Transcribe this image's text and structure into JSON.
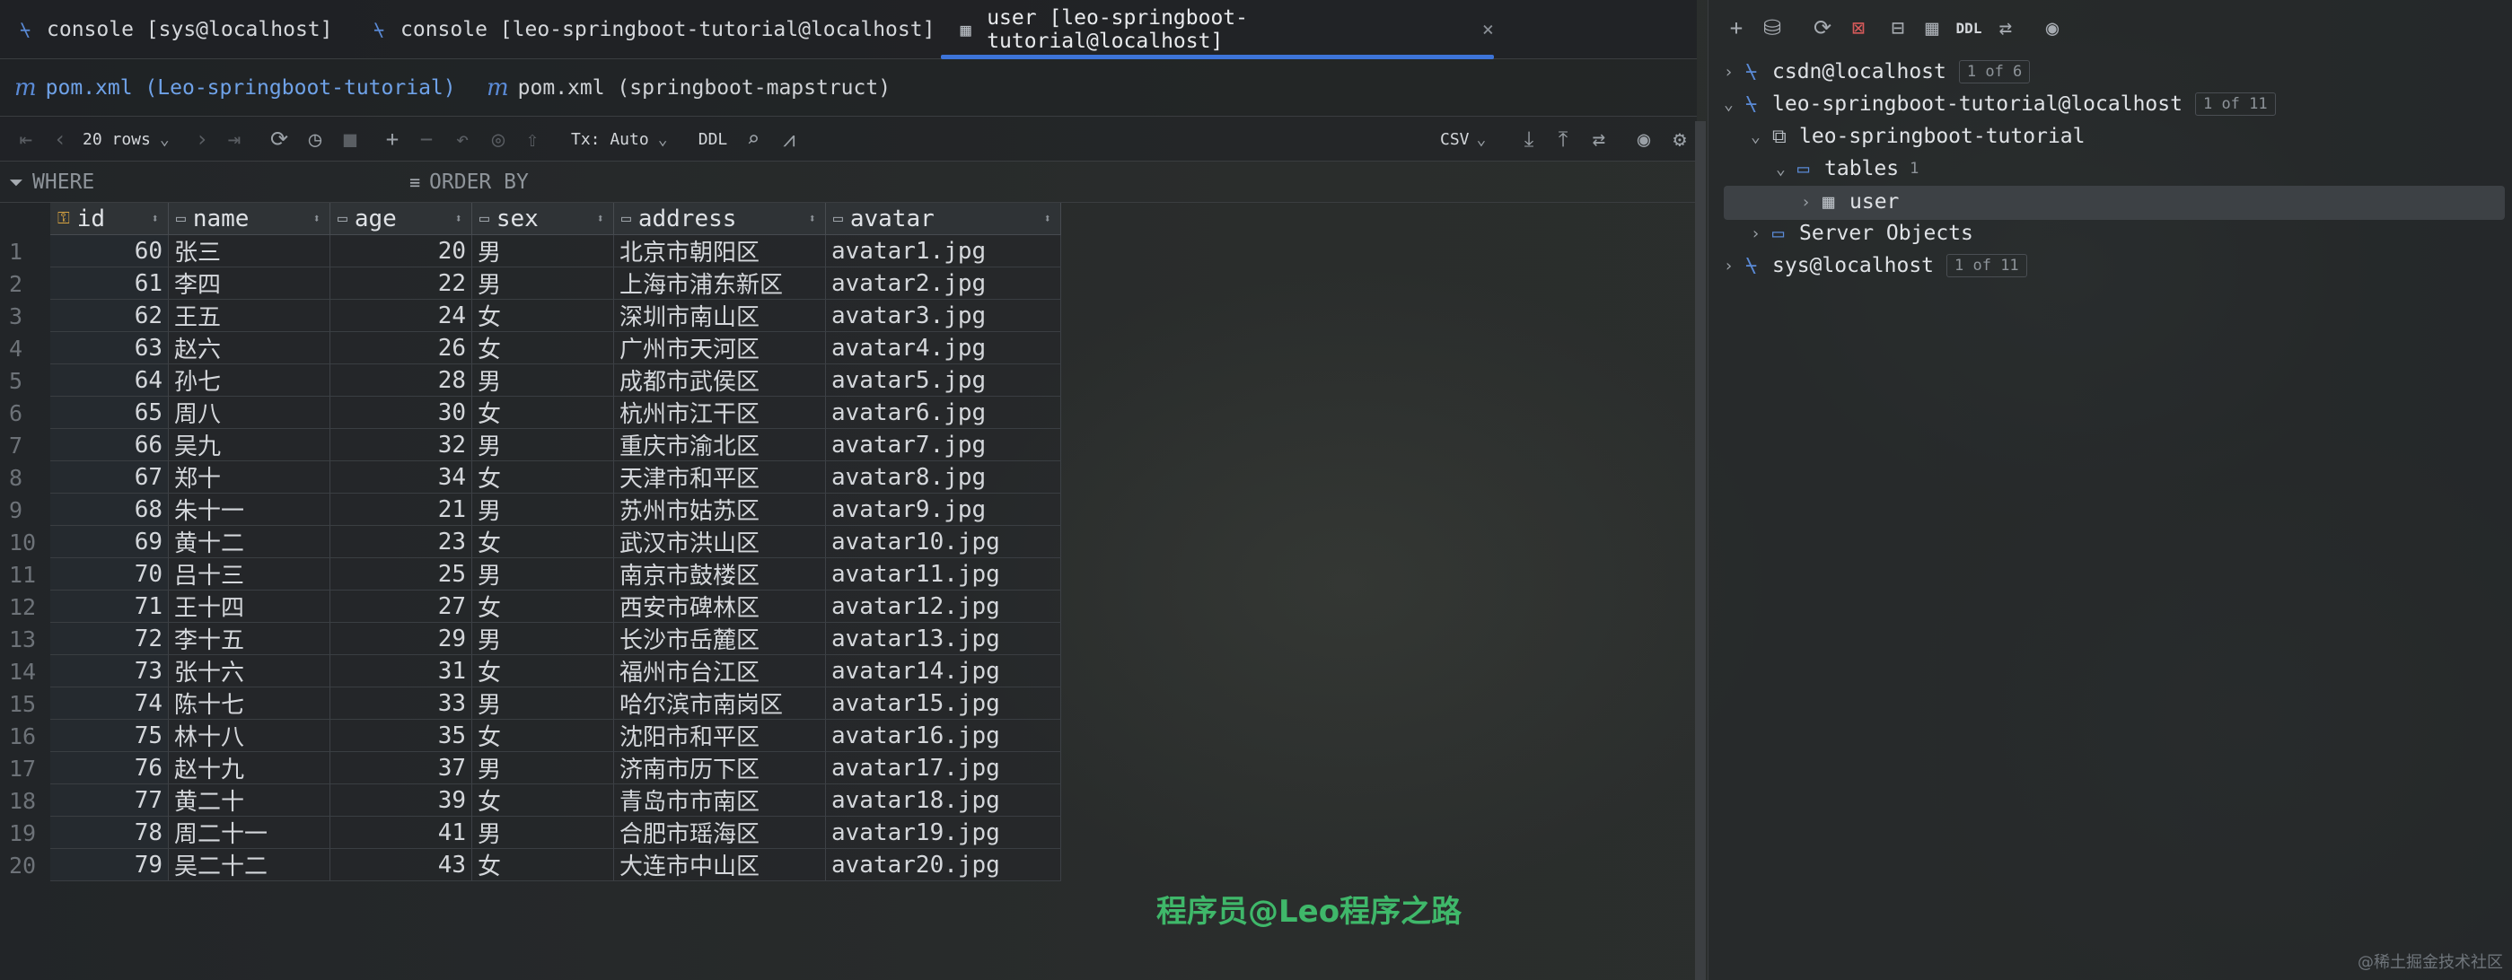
{
  "tabs": [
    {
      "label": "console [sys@localhost]",
      "active": false
    },
    {
      "label": "console [leo-springboot-tutorial@localhost]",
      "active": false
    },
    {
      "label": "user [leo-springboot-tutorial@localhost]",
      "active": true
    }
  ],
  "file_tabs": [
    {
      "label": "pom.xml (Leo-springboot-tutorial)"
    },
    {
      "label": "pom.xml (springboot-mapstruct)"
    }
  ],
  "toolbar": {
    "rows": "20 rows",
    "tx": "Tx: Auto",
    "ddl": "DDL",
    "format": "CSV"
  },
  "filter": {
    "where": "WHERE",
    "order_by": "ORDER BY"
  },
  "columns": [
    "id",
    "name",
    "age",
    "sex",
    "address",
    "avatar"
  ],
  "rows": [
    {
      "n": "1",
      "id": "60",
      "name": "张三",
      "age": "20",
      "sex": "男",
      "address": "北京市朝阳区",
      "avatar": "avatar1.jpg"
    },
    {
      "n": "2",
      "id": "61",
      "name": "李四",
      "age": "22",
      "sex": "男",
      "address": "上海市浦东新区",
      "avatar": "avatar2.jpg"
    },
    {
      "n": "3",
      "id": "62",
      "name": "王五",
      "age": "24",
      "sex": "女",
      "address": "深圳市南山区",
      "avatar": "avatar3.jpg"
    },
    {
      "n": "4",
      "id": "63",
      "name": "赵六",
      "age": "26",
      "sex": "女",
      "address": "广州市天河区",
      "avatar": "avatar4.jpg"
    },
    {
      "n": "5",
      "id": "64",
      "name": "孙七",
      "age": "28",
      "sex": "男",
      "address": "成都市武侯区",
      "avatar": "avatar5.jpg"
    },
    {
      "n": "6",
      "id": "65",
      "name": "周八",
      "age": "30",
      "sex": "女",
      "address": "杭州市江干区",
      "avatar": "avatar6.jpg"
    },
    {
      "n": "7",
      "id": "66",
      "name": "吴九",
      "age": "32",
      "sex": "男",
      "address": "重庆市渝北区",
      "avatar": "avatar7.jpg"
    },
    {
      "n": "8",
      "id": "67",
      "name": "郑十",
      "age": "34",
      "sex": "女",
      "address": "天津市和平区",
      "avatar": "avatar8.jpg"
    },
    {
      "n": "9",
      "id": "68",
      "name": "朱十一",
      "age": "21",
      "sex": "男",
      "address": "苏州市姑苏区",
      "avatar": "avatar9.jpg"
    },
    {
      "n": "10",
      "id": "69",
      "name": "黄十二",
      "age": "23",
      "sex": "女",
      "address": "武汉市洪山区",
      "avatar": "avatar10.jpg"
    },
    {
      "n": "11",
      "id": "70",
      "name": "吕十三",
      "age": "25",
      "sex": "男",
      "address": "南京市鼓楼区",
      "avatar": "avatar11.jpg"
    },
    {
      "n": "12",
      "id": "71",
      "name": "王十四",
      "age": "27",
      "sex": "女",
      "address": "西安市碑林区",
      "avatar": "avatar12.jpg"
    },
    {
      "n": "13",
      "id": "72",
      "name": "李十五",
      "age": "29",
      "sex": "男",
      "address": "长沙市岳麓区",
      "avatar": "avatar13.jpg"
    },
    {
      "n": "14",
      "id": "73",
      "name": "张十六",
      "age": "31",
      "sex": "女",
      "address": "福州市台江区",
      "avatar": "avatar14.jpg"
    },
    {
      "n": "15",
      "id": "74",
      "name": "陈十七",
      "age": "33",
      "sex": "男",
      "address": "哈尔滨市南岗区",
      "avatar": "avatar15.jpg"
    },
    {
      "n": "16",
      "id": "75",
      "name": "林十八",
      "age": "35",
      "sex": "女",
      "address": "沈阳市和平区",
      "avatar": "avatar16.jpg"
    },
    {
      "n": "17",
      "id": "76",
      "name": "赵十九",
      "age": "37",
      "sex": "男",
      "address": "济南市历下区",
      "avatar": "avatar17.jpg"
    },
    {
      "n": "18",
      "id": "77",
      "name": "黄二十",
      "age": "39",
      "sex": "女",
      "address": "青岛市市南区",
      "avatar": "avatar18.jpg"
    },
    {
      "n": "19",
      "id": "78",
      "name": "周二十一",
      "age": "41",
      "sex": "男",
      "address": "合肥市瑶海区",
      "avatar": "avatar19.jpg"
    },
    {
      "n": "20",
      "id": "79",
      "name": "吴二十二",
      "age": "43",
      "sex": "女",
      "address": "大连市中山区",
      "avatar": "avatar20.jpg"
    }
  ],
  "watermark": "程序员@Leo程序之路",
  "corner_mark": "@稀土掘金技术社区",
  "db_tree": {
    "ddl": "DDL",
    "csdn": {
      "label": "csdn@localhost",
      "badge": "1 of 6"
    },
    "leo": {
      "label": "leo-springboot-tutorial@localhost",
      "badge": "1 of 11"
    },
    "schema": {
      "label": "leo-springboot-tutorial"
    },
    "tables": {
      "label": "tables",
      "count": "1"
    },
    "user_table": {
      "label": "user"
    },
    "server_objects": {
      "label": "Server Objects"
    },
    "sys": {
      "label": "sys@localhost",
      "badge": "1 of 11"
    }
  },
  "colors": {
    "accent": "#3d74d9",
    "watermark": "#3fb86a"
  }
}
